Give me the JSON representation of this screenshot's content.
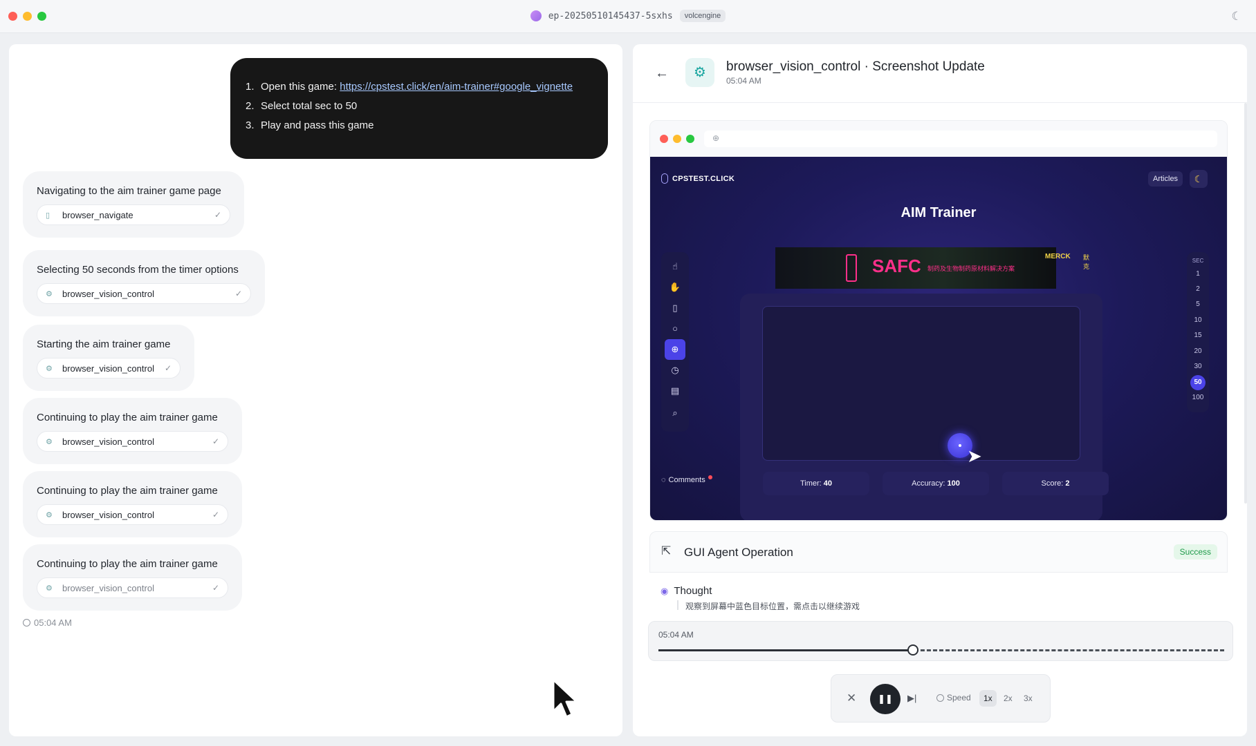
{
  "window": {
    "model_id": "ep-20250510145437-5sxhs",
    "provider": "volcengine",
    "icons": {
      "theme": "moon-icon"
    }
  },
  "chat": {
    "user_steps": [
      {
        "num": "1.",
        "text": "Open this game: ",
        "link": "https://cpstest.click/en/aim-trainer#google_vignette"
      },
      {
        "num": "2.",
        "text": "Select total sec to 50"
      },
      {
        "num": "3.",
        "text": "Play and pass this game"
      }
    ],
    "steps": [
      {
        "title": "Navigating to the aim trainer game page",
        "tool": "browser_navigate",
        "icon": "document-icon"
      },
      {
        "title": "Selecting 50 seconds from the timer options",
        "tool": "browser_vision_control",
        "icon": "gear-icon"
      },
      {
        "title": "Starting the aim trainer game",
        "tool": "browser_vision_control",
        "icon": "gear-icon"
      },
      {
        "title": "Continuing to play the aim trainer game",
        "tool": "browser_vision_control",
        "icon": "gear-icon"
      },
      {
        "title": "Continuing to play the aim trainer game",
        "tool": "browser_vision_control",
        "icon": "gear-icon"
      },
      {
        "title": "Continuing to play the aim trainer game",
        "tool": "browser_vision_control",
        "icon": "gear-icon"
      }
    ],
    "timestamp": "05:04 AM"
  },
  "detail": {
    "title": "browser_vision_control · Screenshot Update",
    "time": "05:04 AM",
    "screenshot": {
      "site_name": "CPSTEST.CLICK",
      "articles_label": "Articles",
      "page_title": "AIM Trainer",
      "ad": {
        "headline": "SAFC",
        "brand": "MERCK",
        "brand_cn": "默克",
        "subline": "制药及生物制药原材料解决方案"
      },
      "sec_header": "SEC",
      "sec_options": [
        "1",
        "2",
        "5",
        "10",
        "15",
        "20",
        "30",
        "50",
        "100"
      ],
      "sec_selected": "50",
      "stats": {
        "timer_label": "Timer:",
        "timer_value": "40",
        "accuracy_label": "Accuracy:",
        "accuracy_value": "100",
        "score_label": "Score:",
        "score_value": "2"
      },
      "comments_label": "Comments"
    },
    "operation": {
      "title": "GUI Agent Operation",
      "status": "Success",
      "thought_label": "Thought",
      "thought_text": "观察到屏幕中蓝色目标位置，需点击以继续游戏"
    },
    "timeline": {
      "time": "05:04 AM",
      "progress": 0.45
    },
    "player": {
      "speed_label": "Speed",
      "rates": [
        "1x",
        "2x",
        "3x"
      ],
      "active_rate": "1x"
    }
  }
}
